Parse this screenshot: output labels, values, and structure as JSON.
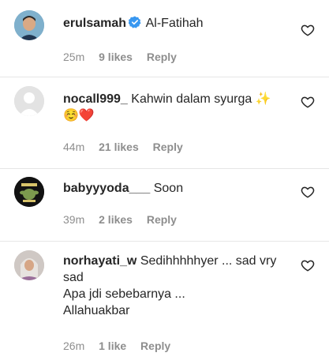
{
  "comments": [
    {
      "username": "erulsamah",
      "verified": true,
      "text": "Al-Fatihah",
      "time": "25m",
      "likes": "9 likes",
      "reply": "Reply"
    },
    {
      "username": "nocall999_",
      "verified": false,
      "text": "Kahwin dalam syurga ✨",
      "text_line2": "☺️❤️",
      "time": "44m",
      "likes": "21 likes",
      "reply": "Reply"
    },
    {
      "username": "babyyyoda___",
      "verified": false,
      "text": "Soon",
      "time": "39m",
      "likes": "2 likes",
      "reply": "Reply"
    },
    {
      "username": "norhayati_w",
      "verified": false,
      "text": "Sedihhhhhyer ... sad vry",
      "text_line2": "sad",
      "text_line3": "Apa jdi sebebarnya ...",
      "text_line4": "Allahuakbar",
      "time": "26m",
      "likes": "1 like",
      "reply": "Reply"
    }
  ],
  "colors": {
    "text": "#262626",
    "meta": "#8e8e8e",
    "verified": "#3897f0",
    "divider": "#e6e6e6"
  },
  "icons": {
    "like": "heart-outline-icon",
    "verified": "verified-badge-icon"
  }
}
